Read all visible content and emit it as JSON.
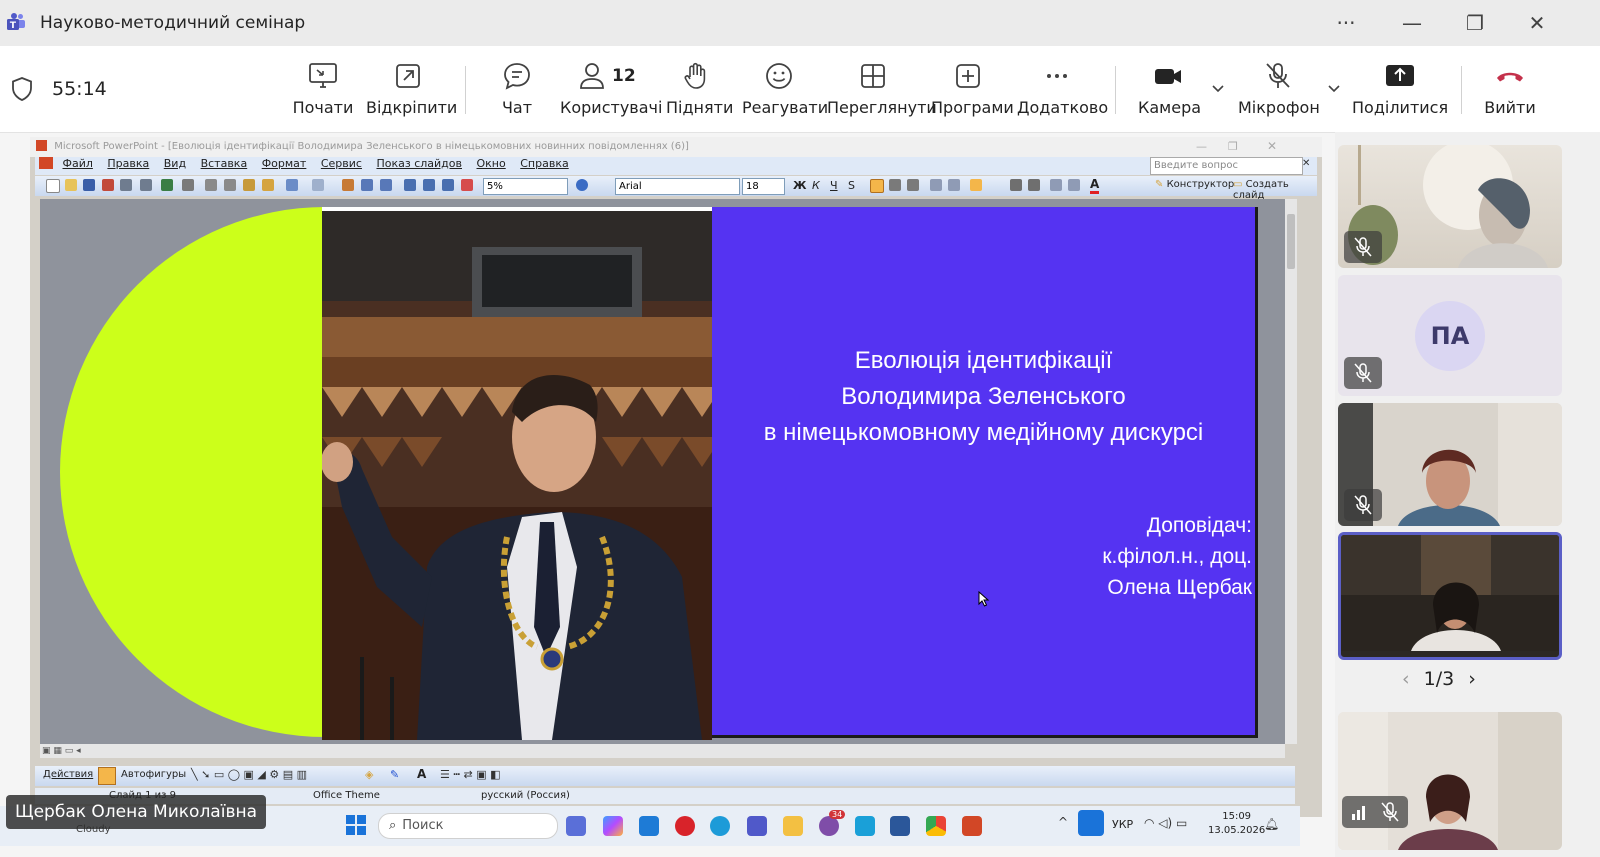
{
  "window": {
    "title": "Науково-методичний семінар",
    "more_label": "···",
    "minimize_label": "—",
    "restore_label": "❐",
    "close_label": "✕"
  },
  "meeting_toolbar": {
    "timer": "55:14",
    "start_label": "Почати",
    "popout_label": "Відкріпити",
    "chat_label": "Чат",
    "participants_count": "12",
    "participants_label": "Користувачі",
    "raise_label": "Підняти",
    "react_label": "Реагувати",
    "view_label": "Переглянути",
    "apps_label": "Програми",
    "more_label": "Додатково",
    "camera_label": "Камера",
    "mic_label": "Мікрофон",
    "share_label": "Поділитися",
    "leave_label": "Вийти",
    "leave_color": "#c4314b"
  },
  "powerpoint": {
    "title": "Microsoft PowerPoint - [Еволюція ідентифікації Володимира Зеленського в німецькомовних новинних повідомленнях (6)]",
    "menu": [
      "Файл",
      "Правка",
      "Вид",
      "Вставка",
      "Формат",
      "Сервис",
      "Показ слайдов",
      "Окно",
      "Справка"
    ],
    "ask_placeholder": "Введите вопрос",
    "zoom": "5%",
    "font_name": "Arial",
    "font_size": "18",
    "designer_label": "Конструктор",
    "new_slide_label": "Создать слайд",
    "actions_label": "Действия",
    "autoshapes_label": "Автофигуры",
    "status_slide": "Слайд 1 из 9",
    "status_theme": "Office Theme",
    "status_lang": "русский (Россия)"
  },
  "slide": {
    "title_lines": [
      "Еволюція ідентифікації",
      "Володимира Зеленського",
      "в німецькомовному медійному дискурсі"
    ],
    "speaker_lines": [
      "Доповідач:",
      "к.філол.н., доц.",
      "Олена Щербак"
    ],
    "background_color": "#5533f2",
    "accent_color": "#ccff1a"
  },
  "presenter_name": "Щербак Олена Миколаївна",
  "taskbar": {
    "search_placeholder": "Поиск",
    "weather": "Cloudy",
    "language": "УКР",
    "time": "15:09",
    "date": "13.05.2026",
    "badge_teams": "",
    "badge_viber": "34"
  },
  "participants_panel": {
    "initials": "ПА",
    "pager": "1/3"
  }
}
